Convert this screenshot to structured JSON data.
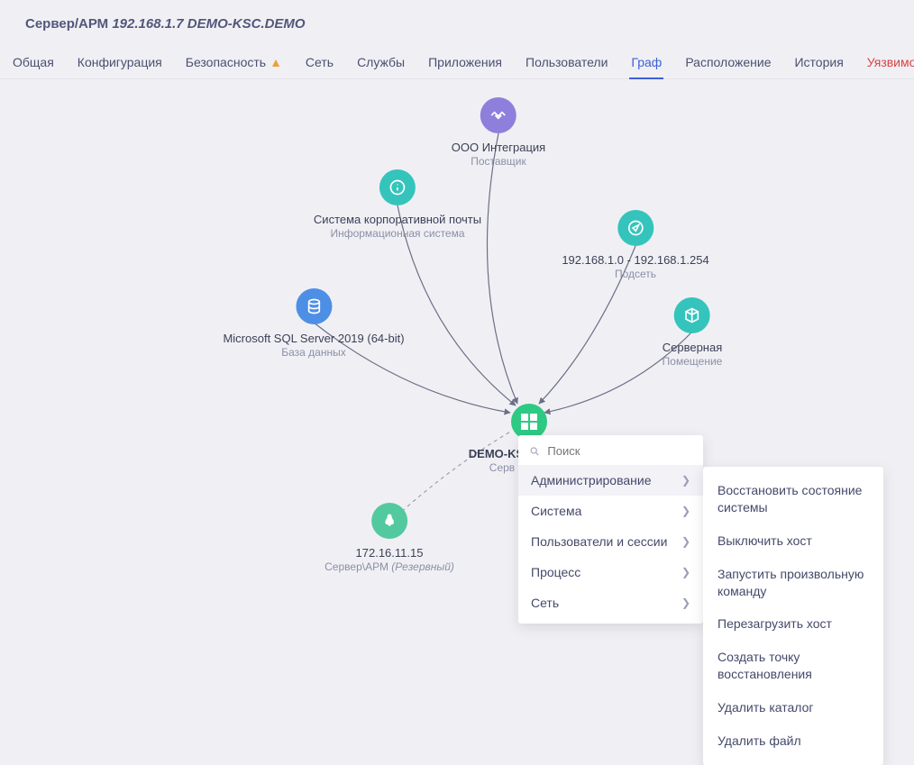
{
  "header": {
    "type_label": "Сервер/АРМ",
    "ip": "192.168.1.7",
    "host": "DEMO-KSC.DEMO"
  },
  "tabs": {
    "items": [
      {
        "label": "Общая"
      },
      {
        "label": "Конфигурация"
      },
      {
        "label": "Безопасность",
        "warn": true
      },
      {
        "label": "Сеть"
      },
      {
        "label": "Службы"
      },
      {
        "label": "Приложения"
      },
      {
        "label": "Пользователи"
      },
      {
        "label": "Граф",
        "active": true
      },
      {
        "label": "Расположение"
      },
      {
        "label": "История"
      },
      {
        "label": "Уязвимости",
        "danger": true
      }
    ]
  },
  "nodes": {
    "org": {
      "title": "ООО Интеграция",
      "subtitle": "Поставщик"
    },
    "mail": {
      "title": "Система корпоративной почты",
      "subtitle": "Информационная система"
    },
    "subnet": {
      "title": "192.168.1.0 - 192.168.1.254",
      "subtitle": "Подсеть"
    },
    "sql": {
      "title": "Microsoft SQL Server 2019 (64-bit)",
      "subtitle": "База данных"
    },
    "room": {
      "title": "Серверная",
      "subtitle": "Помещение"
    },
    "center": {
      "title": "DEMO-KSC.",
      "subtitle": "Серв"
    },
    "backup": {
      "title": "172.16.11.15",
      "subtitle_a": "Сервер\\АРМ",
      "subtitle_b": "(Резервный)"
    }
  },
  "context_menu": {
    "search_placeholder": "Поиск",
    "items": [
      {
        "label": "Администрирование",
        "active": true
      },
      {
        "label": "Система"
      },
      {
        "label": "Пользователи и сессии"
      },
      {
        "label": "Процесс"
      },
      {
        "label": "Сеть"
      }
    ],
    "submenu": [
      "Восстановить состояние системы",
      "Выключить хост",
      "Запустить произвольную команду",
      "Перезагрузить хост",
      "Создать точку восстановления",
      "Удалить каталог",
      "Удалить файл"
    ]
  },
  "colors": {
    "purple": "#8f7fdc",
    "teal": "#35c4bc",
    "blue": "#4e8fe6",
    "green": "#2ec983",
    "mint": "#53c9a0"
  }
}
